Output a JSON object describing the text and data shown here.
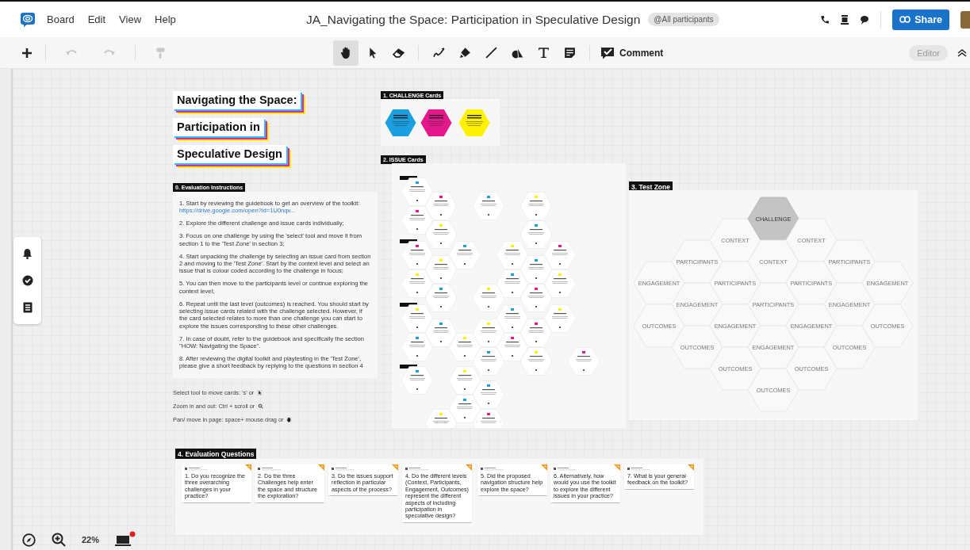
{
  "menu_bar": {
    "items": [
      "Board",
      "Edit",
      "View",
      "Help"
    ],
    "title": "JA_Navigating the Space: Participation in Speculative Design",
    "audience_chip": "@All participants",
    "share_button": "Share"
  },
  "toolbar": {
    "history": [
      {
        "kind": "undo",
        "disabled": true
      },
      {
        "kind": "redo",
        "disabled": true
      },
      {
        "kind": "format",
        "disabled": true
      }
    ],
    "tools": [
      {
        "kind": "hand",
        "selected": true
      },
      {
        "kind": "pointer",
        "selected": false
      },
      {
        "kind": "eraser",
        "selected": false
      },
      {
        "kind": "pen",
        "selected": false
      },
      {
        "kind": "marker",
        "selected": false
      },
      {
        "kind": "line",
        "selected": false
      },
      {
        "kind": "shapes",
        "selected": false
      },
      {
        "kind": "text",
        "selected": false
      },
      {
        "kind": "note",
        "selected": false
      }
    ],
    "comment_button": "Comment",
    "mode_badge": "Editor"
  },
  "board": {
    "title_lines": [
      "Navigating the Space:",
      "Participation in",
      "Speculative Design"
    ],
    "instructions": {
      "label": "0. Evaluation Instructions",
      "steps": [
        {
          "text": "1.   Start by reviewing the guidebook to get an overview of the toolkit:",
          "link": "https://drive.google.com/open?id=1U0nqv..."
        },
        {
          "text": "2.   Explore the different challenge and issue cards individually;"
        },
        {
          "text": "3.   Focus on one challenge by using the 'select' tool and move it from section 1 to the 'Test Zone' in section 3;"
        },
        {
          "text": "4.   Start unpacking the challenge by selecting an issue card from section 2 and moving to the 'Test Zone'. Start by the context level and select an issue that is colour coded according to the challenge in focus;"
        },
        {
          "text": "5.   You can then move to the participants level or continue exploring the context level;"
        },
        {
          "text": "6.   Repeat until the last level (outcomes) is reached. You should start by selecting issue cards related with the challenge selected. However, if the card selected relates to more than one challenge you can start to explore the issues corresponding to these other challenges."
        },
        {
          "text": "7. In case of doubt, refer to the guidebook and specifically the section \"HOW: Navigating the Space\"."
        },
        {
          "text": "8.   After reviewing the digital toolkit and playtesting in the 'Test Zone', please give a short feedback by replying to the questions in section 4"
        }
      ],
      "hints": [
        {
          "text": "Select tool to move cards: 's' or",
          "kind": "pointer"
        },
        {
          "text": "Zoom in and out: Ctrl + scroll or",
          "kind": "zoom"
        },
        {
          "text": "Pan/ move in page: space+ mouse drag or",
          "kind": "hand"
        }
      ]
    },
    "challenge_cards": {
      "label": "1. CHALLENGE Cards",
      "cards": [
        {
          "color": "#1a9fe0"
        },
        {
          "color": "#e6168b"
        },
        {
          "color": "#fff200"
        }
      ]
    },
    "issue_cards": {
      "label": "2. ISSUE Cards"
    },
    "test_zone": {
      "label": "3. Test Zone",
      "columns": [
        [
          {
            "label": "ENGAGEMENT",
            "kind": "slot"
          },
          {
            "label": "OUTCOMES",
            "kind": "slot"
          }
        ],
        [
          {
            "label": "PARTICIPANTS",
            "kind": "slot"
          },
          {
            "label": "ENGAGEMENT",
            "kind": "slot"
          },
          {
            "label": "OUTCOMES",
            "kind": "slot"
          }
        ],
        [
          {
            "label": "CONTEXT",
            "kind": "slot"
          },
          {
            "label": "PARTICIPANTS",
            "kind": "slot"
          },
          {
            "label": "ENGAGEMENT",
            "kind": "slot"
          },
          {
            "label": "OUTCOMES",
            "kind": "slot"
          }
        ],
        [
          {
            "label": "CHALLENGE",
            "kind": "challenge"
          },
          {
            "label": "CONTEXT",
            "kind": "slot"
          },
          {
            "label": "PARTICIPANTS",
            "kind": "slot"
          },
          {
            "label": "ENGAGEMENT",
            "kind": "slot"
          },
          {
            "label": "OUTCOMES",
            "kind": "slot"
          }
        ],
        [
          {
            "label": "CONTEXT",
            "kind": "slot"
          },
          {
            "label": "PARTICIPANTS",
            "kind": "slot"
          },
          {
            "label": "ENGAGEMENT",
            "kind": "slot"
          },
          {
            "label": "OUTCOMES",
            "kind": "slot"
          }
        ],
        [
          {
            "label": "PARTICIPANTS",
            "kind": "slot"
          },
          {
            "label": "ENGAGEMENT",
            "kind": "slot"
          },
          {
            "label": "OUTCOMES",
            "kind": "slot"
          }
        ],
        [
          {
            "label": "ENGAGEMENT",
            "kind": "slot"
          },
          {
            "label": "OUTCOMES",
            "kind": "slot"
          }
        ]
      ]
    },
    "evaluation_questions": {
      "label": "4. Evaluation Questions",
      "questions": [
        "1. Do you recognize the three overarching challenges in your practice?",
        "2. Do the three Challenges help enter the space and structure the exploration?",
        "3. Do the issues support reflection in particular aspects of the process?",
        "4. Do the different levels (Context, Participants, Engagement, Outcomes) represent the different aspects of including participation in speculative design?",
        "5. Did the proposed navigation structure help explore the space?",
        "6. Alternatively, how would you use the toolkit to explore the different issues in your practice?",
        "7. What is your general feedback on the toolkit?"
      ]
    }
  },
  "zoom_level": "22%"
}
